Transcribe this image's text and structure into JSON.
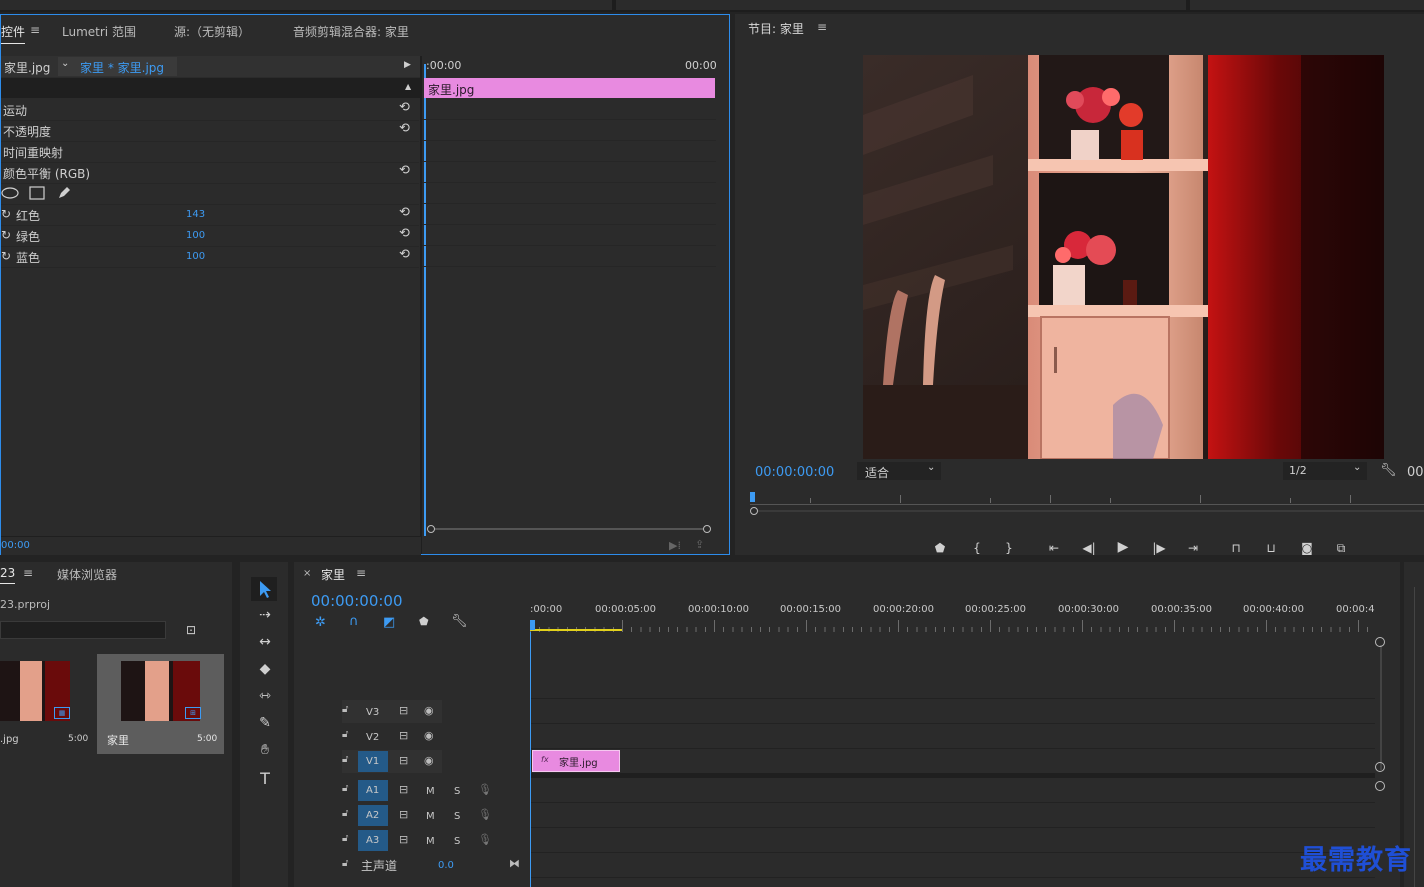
{
  "effect_controls": {
    "tabs": [
      "控件",
      "Lumetri 范围",
      "源:（无剪辑）",
      "音频剪辑混合器: 家里"
    ],
    "menu_icon": "≡",
    "master_clip": "家里.jpg",
    "sequence_clip": "家里 * 家里.jpg",
    "time_start": ":00:00",
    "time_end": "00:00",
    "clip_bar_label": "家里.jpg",
    "rows": [
      {
        "label": "运动"
      },
      {
        "label": "不透明度"
      },
      {
        "label": "时间重映射"
      },
      {
        "label": "颜色平衡 (RGB)"
      },
      {
        "label": "红色",
        "value": "143"
      },
      {
        "label": "绿色",
        "value": "100"
      },
      {
        "label": "蓝色",
        "value": "100"
      }
    ],
    "footer_time": "00:00"
  },
  "program_monitor": {
    "title": "节目: 家里",
    "timecode": "00:00:00:00",
    "fit": "适合",
    "resolution": "1/2",
    "right_time": "00"
  },
  "project_panel": {
    "tab_name": "23",
    "tab_browser": "媒体浏览器",
    "project_file": "23.prproj",
    "items": [
      {
        "name": ".jpg",
        "duration": "5:00"
      },
      {
        "name": "家里",
        "duration": "5:00"
      }
    ]
  },
  "timeline": {
    "close": "×",
    "name": "家里",
    "timecode": "00:00:00:00",
    "ruler": [
      ":00:00",
      "00:00:05:00",
      "00:00:10:00",
      "00:00:15:00",
      "00:00:20:00",
      "00:00:25:00",
      "00:00:30:00",
      "00:00:35:00",
      "00:00:40:00",
      "00:00:4"
    ],
    "video_tracks": [
      "V3",
      "V2",
      "V1"
    ],
    "audio_tracks": [
      "A1",
      "A2",
      "A3"
    ],
    "mute": "M",
    "solo": "S",
    "master_label": "主声道",
    "master_value": "0.0",
    "clip_label": "家里.jpg",
    "clip_fx": "fx"
  },
  "watermark": "最需教育",
  "colors": {
    "accent_blue": "#3d9bf3",
    "clip_pink": "#e88ae0",
    "track_blue": "#245a88",
    "panel_bg": "#2b2b2b",
    "watermark_blue": "#1f4fd6"
  }
}
